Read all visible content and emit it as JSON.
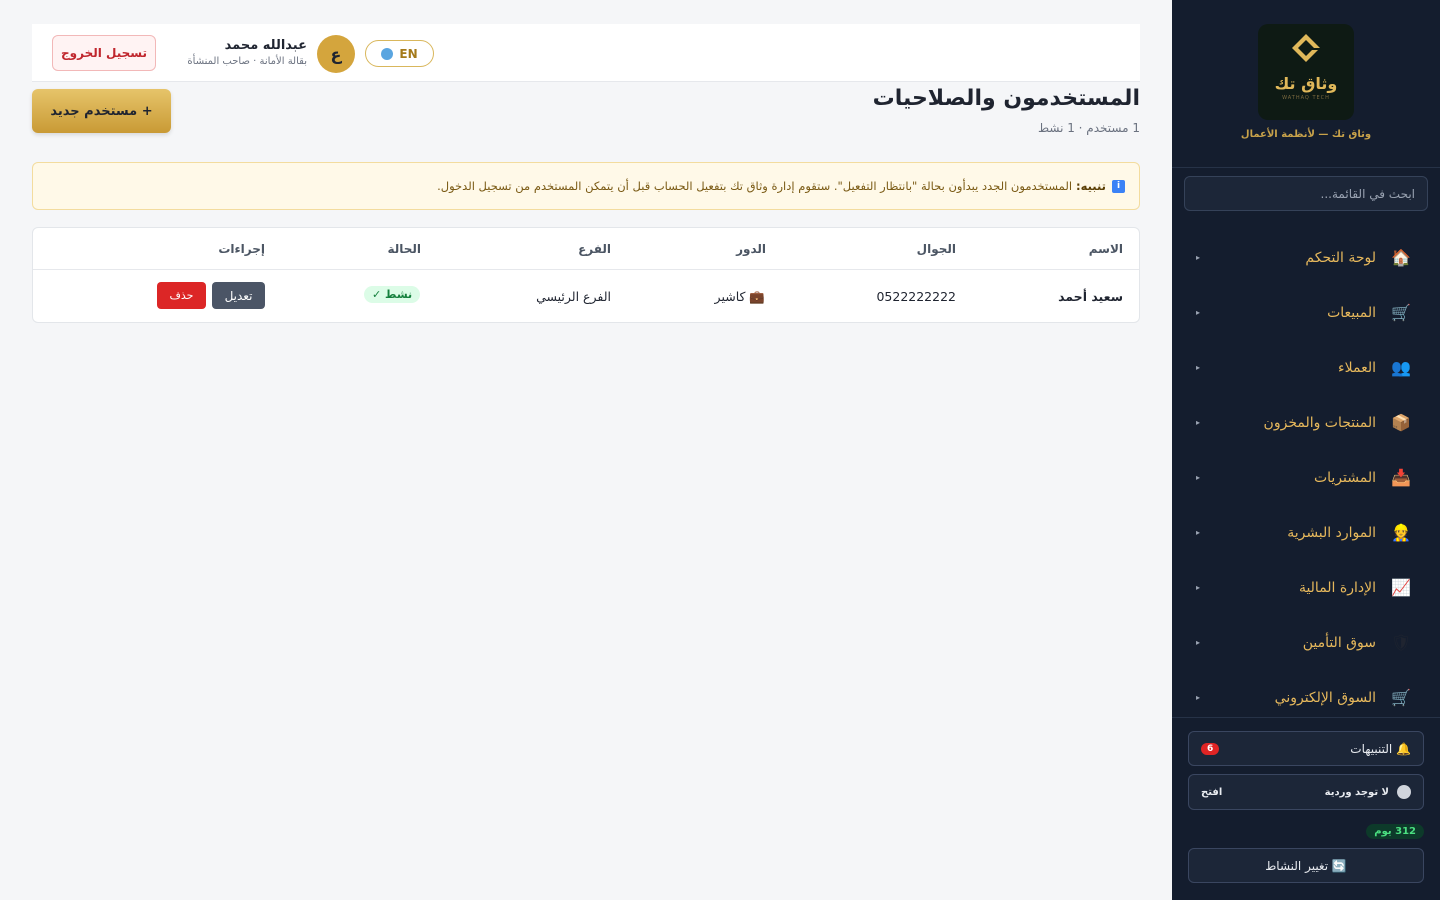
{
  "app": {
    "brand_name": "وثاق تك",
    "brand_sub": "WATHAQ TECH",
    "tagline": "وثاق تك — لأنظمة الأعمال"
  },
  "sidebar": {
    "search_placeholder": "ابحث في القائمة...",
    "items": [
      {
        "label": "لوحة التحكم",
        "icon": "house-icon",
        "glyph": "🏠"
      },
      {
        "label": "المبيعات",
        "icon": "cart-icon",
        "glyph": "🛒"
      },
      {
        "label": "العملاء",
        "icon": "users-icon",
        "glyph": "👥"
      },
      {
        "label": "المنتجات والمخزون",
        "icon": "box-icon",
        "glyph": "📦"
      },
      {
        "label": "المشتريات",
        "icon": "inbox-icon",
        "glyph": "📥"
      },
      {
        "label": "الموارد البشرية",
        "icon": "worker-icon",
        "glyph": "👷"
      },
      {
        "label": "الإدارة المالية",
        "icon": "chart-up-icon",
        "glyph": "📈"
      },
      {
        "label": "سوق التأمين",
        "icon": "shield-icon",
        "glyph": "🛡"
      },
      {
        "label": "السوق الإلكتروني",
        "icon": "cart-icon",
        "glyph": "🛒"
      }
    ],
    "arrow": "▸",
    "alerts": {
      "label": "🔔 التنبيهات",
      "count": "6"
    },
    "shift": {
      "status": "لا توجد وردية",
      "open_label": "افتح"
    },
    "days": "312 يوم",
    "change_activity": "🔄 تغيير النشاط"
  },
  "topbar": {
    "logout": "تسجيل الخروج",
    "user_name": "عبدالله محمد",
    "user_sub": "بقالة الأمانة · صاحب المنشأة",
    "avatar_letter": "ع",
    "lang": "EN"
  },
  "page": {
    "title": "المستخدمون والصلاحيات",
    "subtitle": "1 مستخدم · 1 نشط",
    "new_user": "+ مستخدم جديد"
  },
  "notice": {
    "icon": "i",
    "label": "تنبيه:",
    "text": "المستخدمون الجدد يبدأون بحالة \"بانتظار التفعيل\". ستقوم إدارة وثاق تك بتفعيل الحساب قبل أن يتمكن المستخدم من تسجيل الدخول."
  },
  "table": {
    "headers": [
      "الاسم",
      "الجوال",
      "الدور",
      "الفرع",
      "الحالة",
      "إجراءات"
    ],
    "rows": [
      {
        "name": "سعيد أحمد",
        "phone": "0522222222",
        "role": "💼 كاشير",
        "branch": "الفرع الرئيسي",
        "status": "نشط ✓",
        "edit": "تعديل",
        "delete": "حذف"
      }
    ]
  }
}
